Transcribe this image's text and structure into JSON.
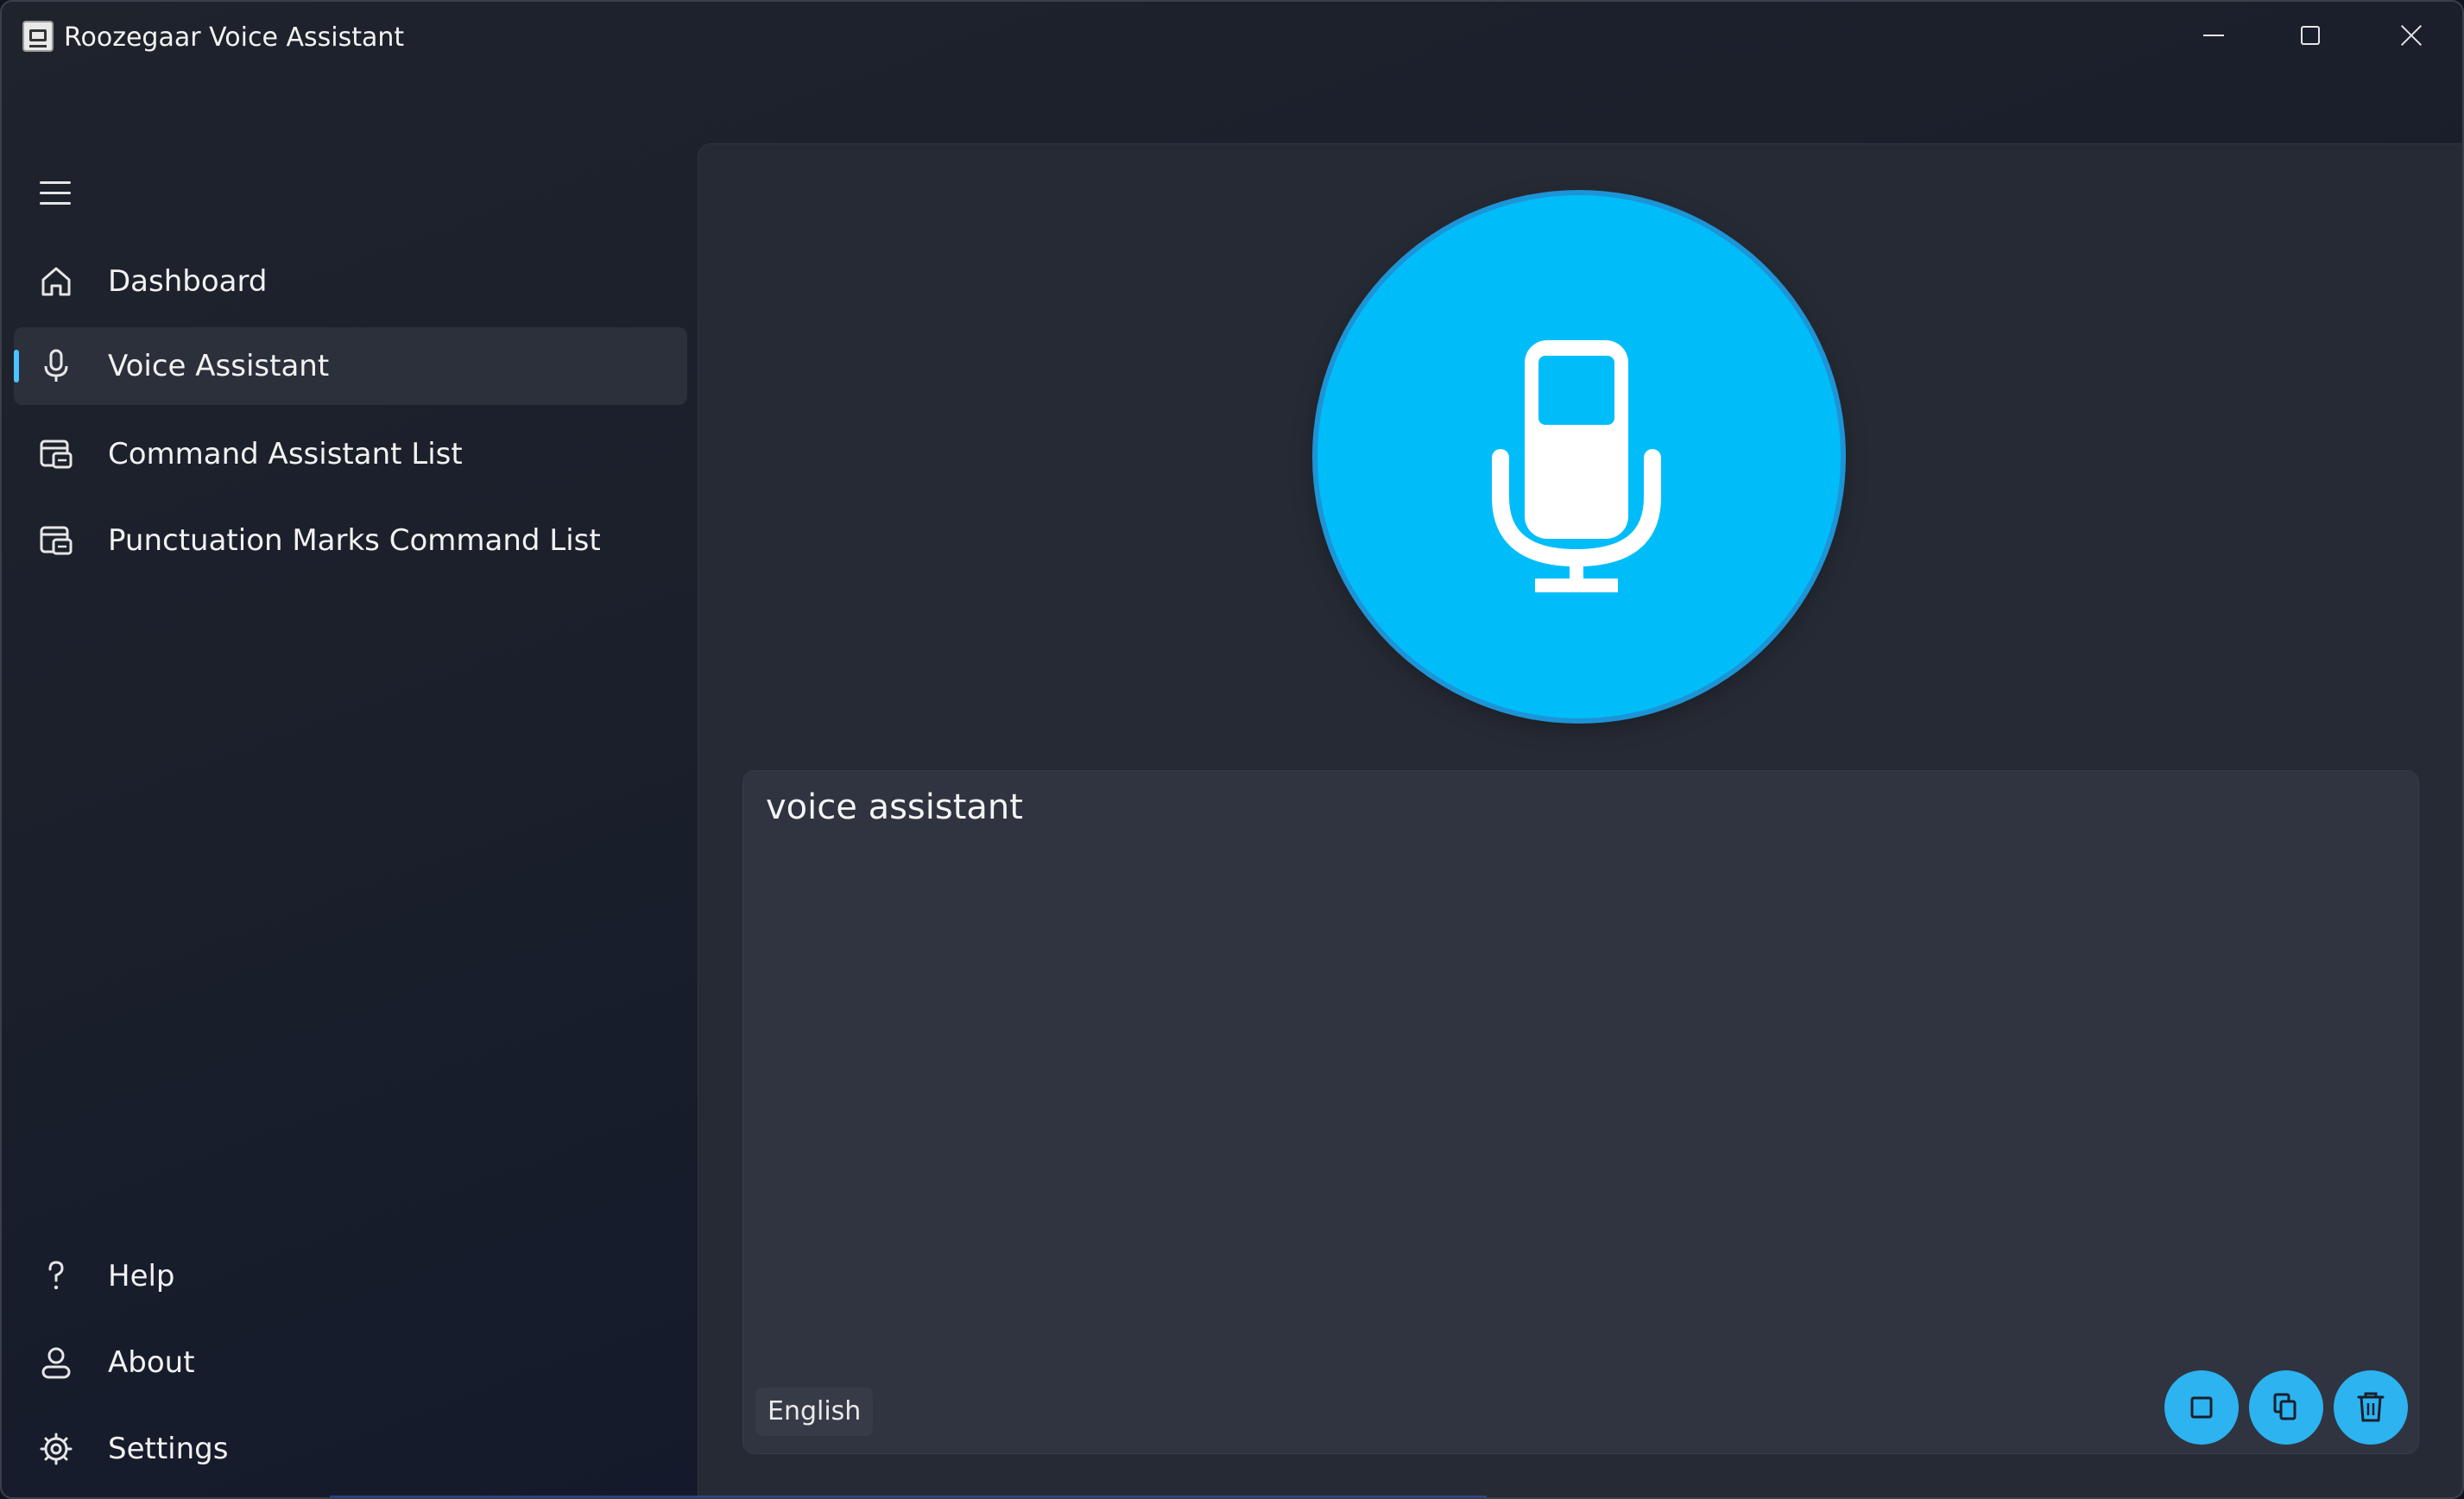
{
  "window": {
    "title": "Roozegaar Voice Assistant",
    "icon": "app-logo-icon"
  },
  "colors": {
    "accent": "#4cc2ff",
    "mic_button": "#00bdfa",
    "action_button": "#2cb3f0",
    "content_bg": "#262a34",
    "text_area_bg": "#2f3440"
  },
  "sidebar": {
    "menu_icon": "hamburger-menu-icon",
    "items": [
      {
        "label": "Dashboard",
        "icon": "home-icon",
        "selected": false
      },
      {
        "label": "Voice Assistant",
        "icon": "microphone-icon",
        "selected": true
      },
      {
        "label": "Command Assistant List",
        "icon": "command-list-icon",
        "selected": false
      },
      {
        "label": "Punctuation Marks Command List",
        "icon": "command-list-icon",
        "selected": false
      }
    ],
    "footer_items": [
      {
        "label": "Help",
        "icon": "question-icon"
      },
      {
        "label": "About",
        "icon": "person-icon"
      },
      {
        "label": "Settings",
        "icon": "gear-icon"
      }
    ]
  },
  "main": {
    "mic_button_icon": "microphone-icon",
    "transcript": "voice assistant",
    "language": "English",
    "actions": [
      {
        "name": "stop",
        "icon": "stop-icon"
      },
      {
        "name": "copy",
        "icon": "copy-icon"
      },
      {
        "name": "clear",
        "icon": "trash-icon"
      }
    ]
  }
}
